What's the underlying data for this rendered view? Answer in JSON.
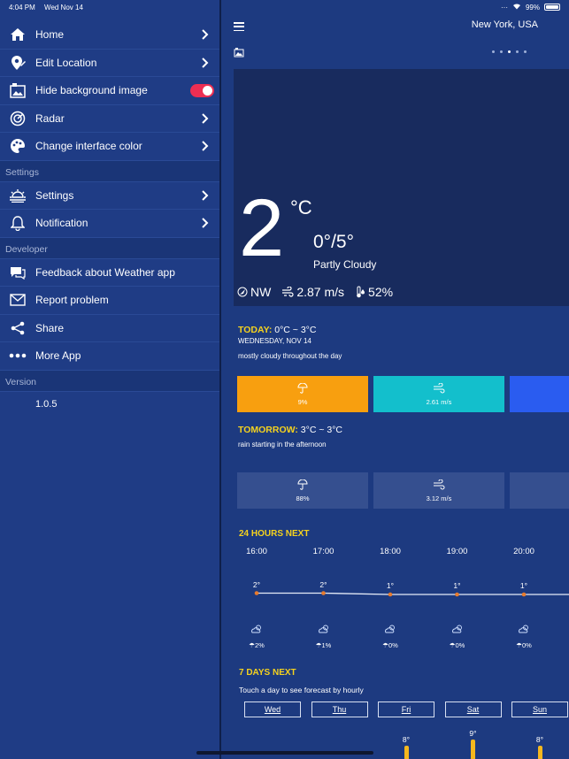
{
  "status": {
    "time": "4:04 PM",
    "date": "Wed Nov 14",
    "battery": "99%",
    "battery_level": 0.99
  },
  "sidebar": {
    "items": [
      {
        "label": "Home",
        "icon": "home-icon"
      },
      {
        "label": "Edit Location",
        "icon": "location-edit-icon"
      },
      {
        "label": "Hide background image",
        "icon": "image-lock-icon",
        "toggle": true
      },
      {
        "label": "Radar",
        "icon": "radar-icon"
      },
      {
        "label": "Change interface color",
        "icon": "palette-icon"
      }
    ],
    "settings_header": "Settings",
    "settings_items": [
      {
        "label": "Settings",
        "icon": "sun-settings-icon"
      },
      {
        "label": "Notification",
        "icon": "bell-icon"
      }
    ],
    "developer_header": "Developer",
    "developer_items": [
      {
        "label": "Feedback about Weather app",
        "icon": "chat-icon"
      },
      {
        "label": "Report problem",
        "icon": "mail-icon"
      },
      {
        "label": "Share",
        "icon": "share-icon"
      },
      {
        "label": "More App",
        "icon": "more-icon"
      }
    ],
    "version_header": "Version",
    "version": "1.0.5"
  },
  "main": {
    "location": "New York, USA",
    "page_count": 5,
    "active_page": 3,
    "current": {
      "temp": "2",
      "unit": "°C",
      "range": "0°/5°",
      "condition": "Partly Cloudy",
      "wind_dir": "NW",
      "wind_speed": "2.87 m/s",
      "humidity": "52%"
    },
    "today": {
      "label": "TODAY:",
      "range": "0°C ~ 3°C",
      "date": "WEDNESDAY, NOV 14",
      "desc": "mostly cloudy throughout the day",
      "cards": [
        {
          "value": "9%",
          "icon": "umbrella-icon",
          "color": "#f89f0f"
        },
        {
          "value": "2.61 m/s",
          "icon": "wind-icon",
          "color": "#13bfcc"
        },
        {
          "value": "",
          "icon": "",
          "color": "#2a5cf0"
        }
      ]
    },
    "tomorrow": {
      "label": "TOMORROW:",
      "range": "3°C ~ 3°C",
      "desc": "rain starting in the afternoon",
      "cards": [
        {
          "value": "88%",
          "icon": "umbrella-icon"
        },
        {
          "value": "3.12 m/s",
          "icon": "wind-icon"
        },
        {
          "value": "",
          "icon": ""
        }
      ]
    },
    "hours_title": "24 HOURS NEXT",
    "hours": [
      {
        "time": "16:00",
        "temp": "2°",
        "temp_value": 2,
        "rain": "2%"
      },
      {
        "time": "17:00",
        "temp": "2°",
        "temp_value": 2,
        "rain": "1%"
      },
      {
        "time": "18:00",
        "temp": "1°",
        "temp_value": 1,
        "rain": "0%"
      },
      {
        "time": "19:00",
        "temp": "1°",
        "temp_value": 1,
        "rain": "0%"
      },
      {
        "time": "20:00",
        "temp": "1°",
        "temp_value": 1,
        "rain": "0%"
      }
    ],
    "days_title": "7 DAYS NEXT",
    "days_sub": "Touch a day to see forecast by hourly",
    "days": [
      {
        "label": "Wed",
        "temp": "",
        "temp_value": null
      },
      {
        "label": "Thu",
        "temp": "",
        "temp_value": null
      },
      {
        "label": "Fri",
        "temp": "8°",
        "temp_value": 8
      },
      {
        "label": "Sat",
        "temp": "9°",
        "temp_value": 9
      },
      {
        "label": "Sun",
        "temp": "8°",
        "temp_value": 8
      }
    ]
  }
}
